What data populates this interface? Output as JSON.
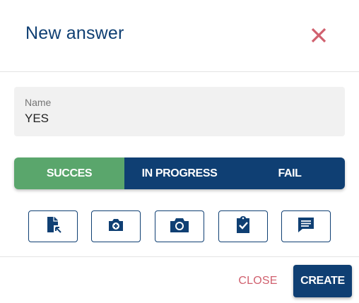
{
  "dialog": {
    "title": "New answer",
    "close_icon": "close-x-icon"
  },
  "name_field": {
    "label": "Name",
    "value": "YES"
  },
  "status": {
    "options": [
      {
        "label": "SUCCES",
        "color": "#5aa66c",
        "selected": true
      },
      {
        "label": "IN PROGRESS",
        "color": "#0f3f73",
        "selected": false
      },
      {
        "label": "FAIL",
        "color": "#0f3f73",
        "selected": false
      }
    ]
  },
  "attachments": {
    "icons": [
      "file-attach-icon",
      "add-photo-icon",
      "camera-icon",
      "checklist-icon",
      "comment-icon"
    ]
  },
  "footer": {
    "close_label": "CLOSE",
    "create_label": "CREATE"
  },
  "colors": {
    "primary": "#0f3f73",
    "success": "#5aa66c",
    "danger": "#d0606e"
  }
}
